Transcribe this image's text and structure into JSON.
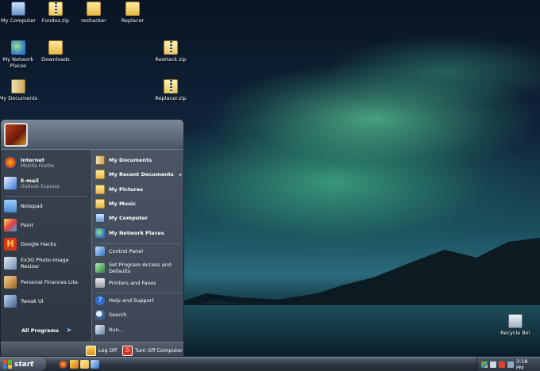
{
  "desktop": {
    "icons": [
      {
        "label": "My Computer",
        "icon": "my-computer-icon"
      },
      {
        "label": "Fondos.zip",
        "icon": "zip-folder-icon"
      },
      {
        "label": "reshacker",
        "icon": "folder-icon"
      },
      {
        "label": "Replacer",
        "icon": "folder-icon"
      },
      {
        "label": "My Network Places",
        "icon": "network-places-icon"
      },
      {
        "label": "Downloads",
        "icon": "folder-icon"
      },
      {
        "label": "ResHack.zip",
        "icon": "zip-folder-icon"
      },
      {
        "label": "My Documents",
        "icon": "my-documents-icon"
      },
      {
        "label": "Replacer.zip",
        "icon": "zip-folder-icon"
      },
      {
        "label": "Recycle Bin",
        "icon": "recycle-bin-icon"
      }
    ]
  },
  "start_menu": {
    "pinned": [
      {
        "label": "Internet",
        "sub": "Mozilla Firefox",
        "icon": "firefox-icon"
      },
      {
        "label": "E-mail",
        "sub": "Outlook Express",
        "icon": "outlook-express-icon"
      }
    ],
    "recent": [
      {
        "label": "Notepad",
        "icon": "notepad-icon"
      },
      {
        "label": "Paint",
        "icon": "paint-icon"
      },
      {
        "label": "Google Hacks",
        "icon": "google-hacks-icon"
      },
      {
        "label": "Ex3O Photo-Image Resizer",
        "icon": "image-resizer-icon"
      },
      {
        "label": "Personal Finances Lite",
        "icon": "finances-icon"
      },
      {
        "label": "Tweak UI",
        "icon": "tweak-ui-icon"
      }
    ],
    "all_programs": "All Programs",
    "places": [
      {
        "label": "My Documents",
        "icon": "my-documents-icon"
      },
      {
        "label": "My Recent Documents",
        "icon": "recent-documents-icon",
        "arrow": "▸"
      },
      {
        "label": "My Pictures",
        "icon": "my-pictures-icon"
      },
      {
        "label": "My Music",
        "icon": "my-music-icon"
      },
      {
        "label": "My Computer",
        "icon": "my-computer-icon"
      },
      {
        "label": "My Network Places",
        "icon": "network-places-icon"
      }
    ],
    "settings": [
      {
        "label": "Control Panel",
        "icon": "control-panel-icon"
      },
      {
        "label": "Set Program Access and Defaults",
        "icon": "program-access-icon"
      },
      {
        "label": "Printers and Faxes",
        "icon": "printer-icon"
      }
    ],
    "tools": [
      {
        "label": "Help and Support",
        "icon": "help-icon"
      },
      {
        "label": "Search",
        "icon": "search-icon"
      },
      {
        "label": "Run...",
        "icon": "run-icon"
      }
    ],
    "footer": {
      "log_off": "Log Off",
      "turn_off": "Turn Off Computer"
    }
  },
  "taskbar": {
    "start_label": "start",
    "clock": "3:18 PM"
  }
}
